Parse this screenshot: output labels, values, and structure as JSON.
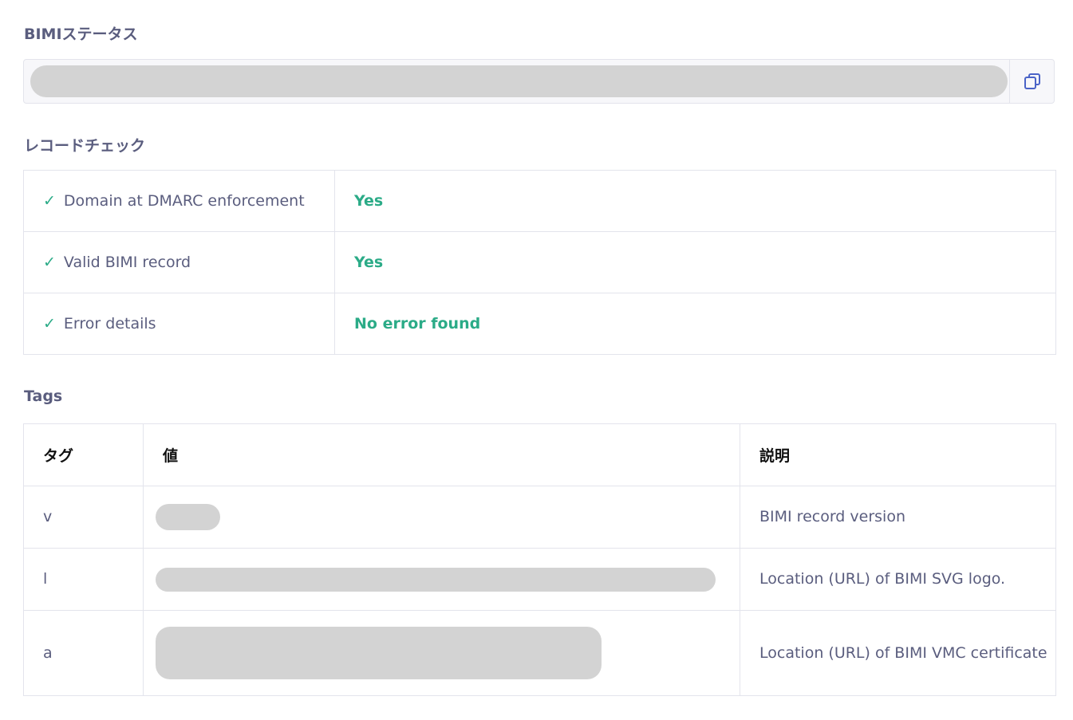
{
  "status_section": {
    "title": "BIMIステータス",
    "copy_icon": "copy-icon"
  },
  "check_section": {
    "title": "レコードチェック",
    "check_mark": "✓",
    "rows": [
      {
        "label": "Domain at DMARC enforcement",
        "value": "Yes"
      },
      {
        "label": "Valid BIMI record",
        "value": "Yes"
      },
      {
        "label": "Error details",
        "value": "No error found"
      }
    ],
    "value_color": "#2bab87"
  },
  "tags_section": {
    "title": "Tags",
    "headers": [
      "タグ",
      "値",
      "説明"
    ],
    "rows": [
      {
        "tag": "v",
        "description": "BIMI record version"
      },
      {
        "tag": "l",
        "description": "Location (URL) of BIMI SVG logo."
      },
      {
        "tag": "a",
        "description": "Location (URL) of BIMI VMC certificate"
      }
    ]
  }
}
